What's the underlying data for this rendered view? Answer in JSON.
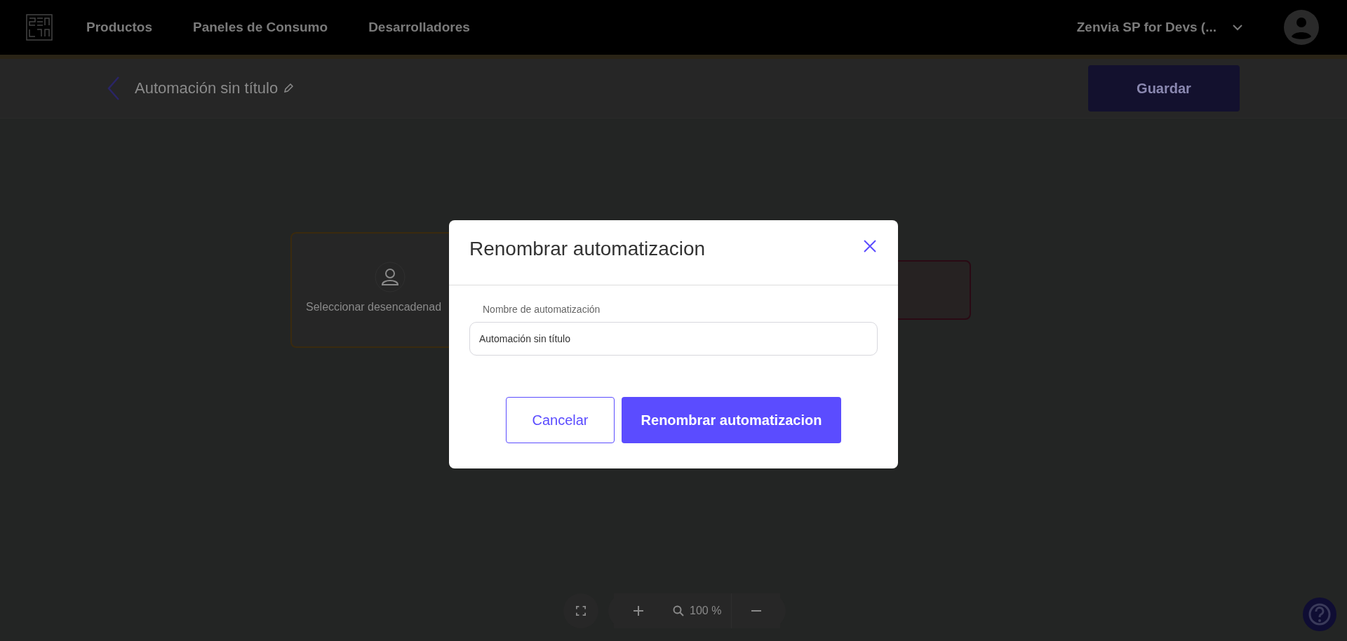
{
  "nav": {
    "items": [
      "Productos",
      "Paneles de Consumo",
      "Desarrolladores"
    ],
    "account": "Zenvia SP for Devs (..."
  },
  "toolbar": {
    "title": "Automación sin título",
    "save_button": "Guardar"
  },
  "canvas": {
    "nodes": [
      {
        "kind": "trigger",
        "label": "Seleccionar desencadenad"
      },
      {
        "kind": "action"
      }
    ]
  },
  "zoom_controls": {
    "level": "100 %"
  },
  "dialog": {
    "title": "Renombrar automatizacion",
    "field": {
      "label": "Nombre de automatización",
      "value": "Automación sin título"
    },
    "buttons": [
      {
        "label": "Cancelar",
        "kind": "secondary"
      },
      {
        "label": "Renombrar automatizacion",
        "kind": "primary"
      }
    ]
  }
}
